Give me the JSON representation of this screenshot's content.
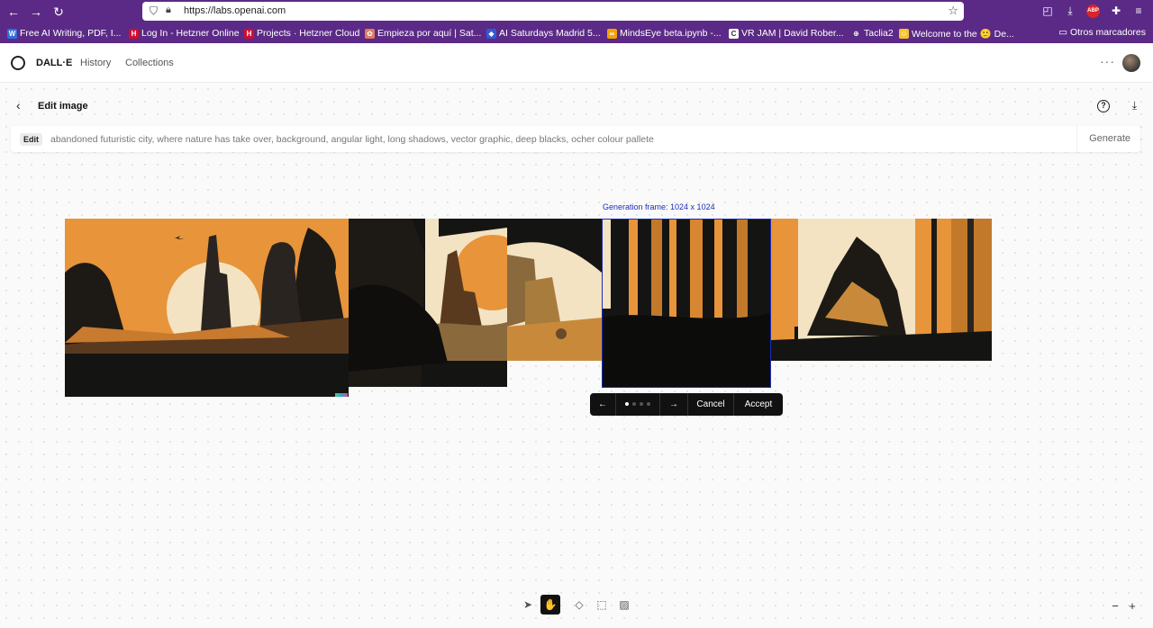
{
  "browser": {
    "url": "https://labs.openai.com",
    "bookmarks": [
      {
        "label": "Free AI Writing, PDF, I...",
        "fav_color": "#2f6fde",
        "fav_text": "W"
      },
      {
        "label": "Log In - Hetzner Online",
        "fav_color": "#d50c2d",
        "fav_text": "H"
      },
      {
        "label": "Projects · Hetzner Cloud",
        "fav_color": "#d50c2d",
        "fav_text": "H"
      },
      {
        "label": "Empieza por aquí | Sat...",
        "fav_color": "#e07a5f",
        "fav_text": "✿"
      },
      {
        "label": "AI Saturdays Madrid 5...",
        "fav_color": "#2f5bd6",
        "fav_text": "◆"
      },
      {
        "label": "MindsEye beta.ipynb -...",
        "fav_color": "#f4a300",
        "fav_text": "∞"
      },
      {
        "label": "VR JAM | David Rober...",
        "fav_color": "#ffffff",
        "fav_text": "C"
      },
      {
        "label": "Taclia2",
        "fav_color": "#5b2a86",
        "fav_text": "⊕"
      },
      {
        "label": "Welcome to the 🙂 De...",
        "fav_color": "#f4c430",
        "fav_text": "☺"
      }
    ],
    "other_bookmarks": "Otros marcadores"
  },
  "header": {
    "brand": "DALL·E",
    "nav": [
      "History",
      "Collections"
    ]
  },
  "edit": {
    "title": "Edit image",
    "tag": "Edit",
    "prompt": "abandoned futuristic city, where nature has take over, background, angular light, long shadows, vector graphic, deep blacks, ocher colour pallete",
    "generate": "Generate"
  },
  "frame": {
    "label": "Generation frame: 1024 x 1024"
  },
  "variants": {
    "cancel": "Cancel",
    "accept": "Accept",
    "total": 4,
    "current": 1
  },
  "colors": {
    "chrome": "#5b2a86",
    "ocher": "#e8943a",
    "cream": "#f3e3c3",
    "black": "#141413",
    "frame_blue": "#1a2db5"
  },
  "tools": [
    "select-icon",
    "hand-icon",
    "eraser-icon",
    "add-frame-icon",
    "upload-image-icon"
  ],
  "zoom": {
    "minus": "−",
    "plus": "+"
  }
}
